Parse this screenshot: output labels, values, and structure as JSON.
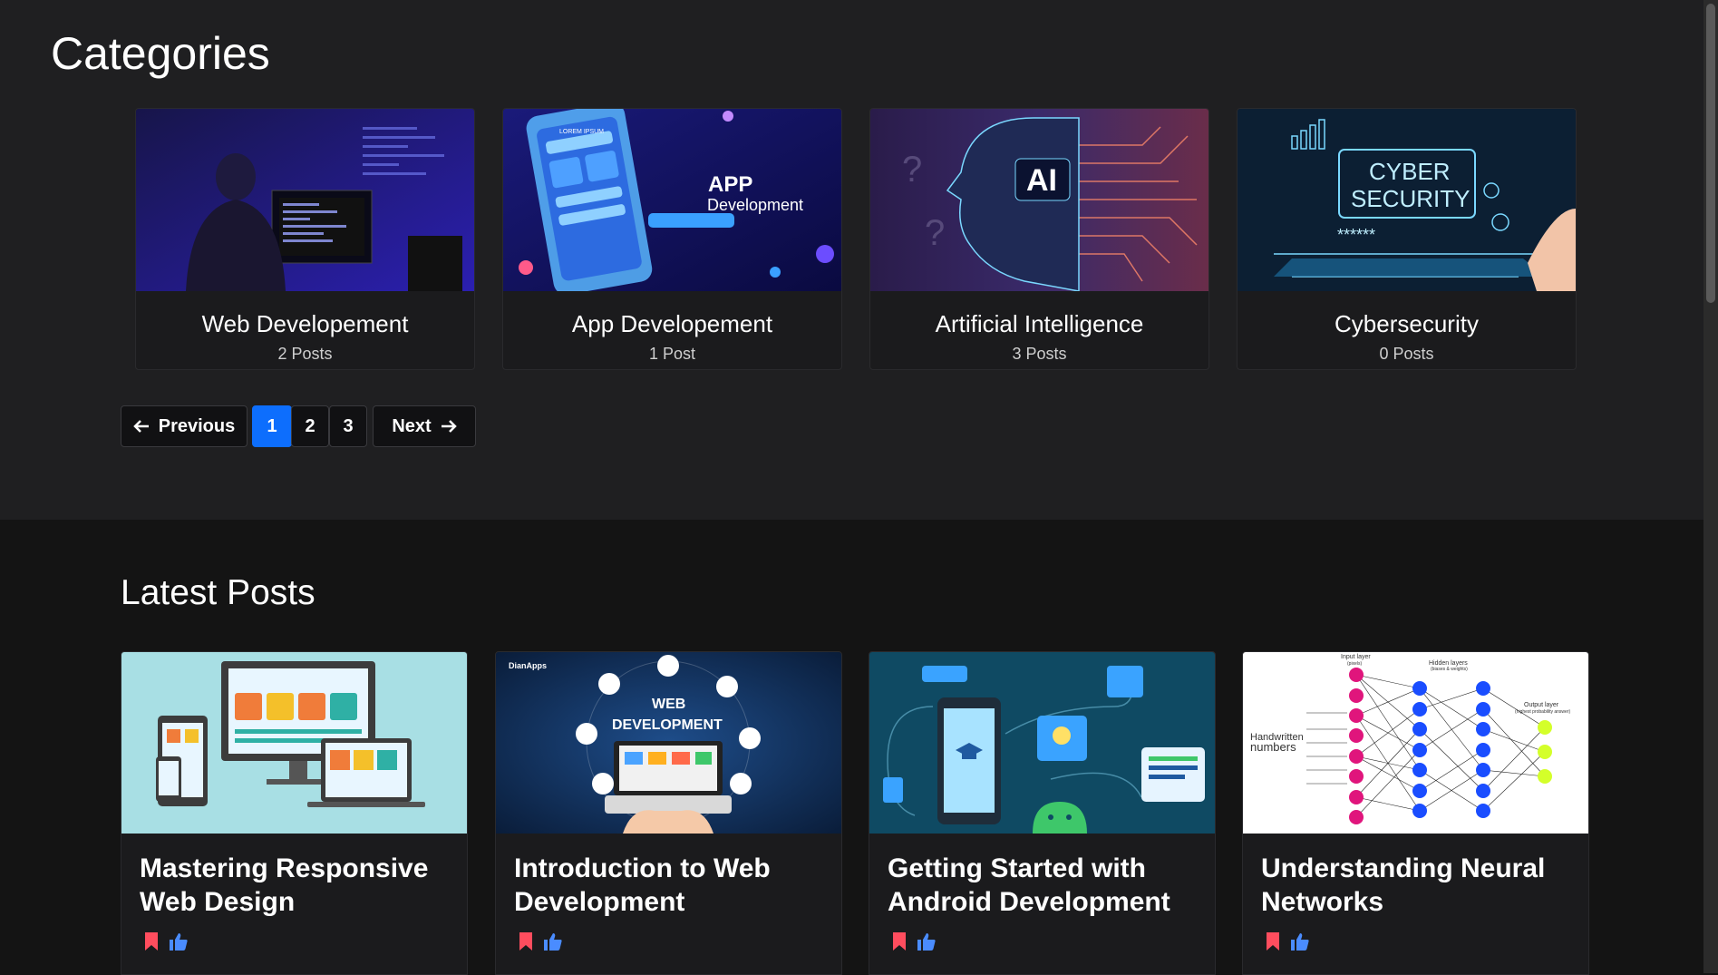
{
  "categories": {
    "title": "Categories",
    "items": [
      {
        "name": "Web Developement",
        "count": "2 Posts"
      },
      {
        "name": "App Developement",
        "count": "1 Post"
      },
      {
        "name": "Artificial Intelligence",
        "count": "3 Posts"
      },
      {
        "name": "Cybersecurity",
        "count": "0 Posts"
      }
    ],
    "image_text": {
      "app_title": "APP",
      "app_sub": "Development",
      "app_lorem": "LOREM IPSUM",
      "ai": "AI",
      "cyber1": "CYBER",
      "cyber2": "SECURITY",
      "cyber_pw": "******"
    }
  },
  "pagination": {
    "previous": "Previous",
    "pages": [
      "1",
      "2",
      "3"
    ],
    "current": "1",
    "next": "Next"
  },
  "latest": {
    "title": "Latest Posts",
    "posts": [
      {
        "title": "Mastering Responsive Web Design"
      },
      {
        "title": "Introduction to Web Development"
      },
      {
        "title": "Getting Started with Android Development"
      },
      {
        "title": "Understanding Neural Networks"
      }
    ],
    "image_text": {
      "webdev_brand": "DianApps",
      "webdev_line1": "WEB",
      "webdev_line2": "DEVELOPMENT",
      "nn_input": "Input layer",
      "nn_input_sub": "(pixels)",
      "nn_hidden": "Hidden layers",
      "nn_hidden_sub": "(biases & weights)",
      "nn_output": "Output layer",
      "nn_output_sub": "(highest probability answer)",
      "nn_hand1": "Handwritten",
      "nn_hand2": "numbers"
    }
  },
  "colors": {
    "accent": "#0d6efd",
    "bookmark": "#ff4d5e",
    "like": "#4a8cff"
  }
}
